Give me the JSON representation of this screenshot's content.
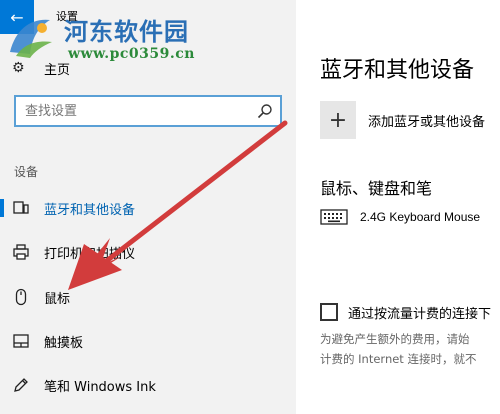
{
  "window": {
    "title": "设置",
    "back_glyph": "←"
  },
  "watermark": {
    "name": "河东软件园",
    "url": "www.pc0359.cn"
  },
  "sidebar": {
    "home_label": "主页",
    "search": {
      "placeholder": "查找设置",
      "value": ""
    },
    "section_label": "设备",
    "items": [
      {
        "label": "蓝牙和其他设备",
        "icon": "bluetooth-devices-icon",
        "active": true
      },
      {
        "label": "打印机和扫描仪",
        "icon": "printer-icon",
        "active": false
      },
      {
        "label": "鼠标",
        "icon": "mouse-icon",
        "active": false
      },
      {
        "label": "触摸板",
        "icon": "touchpad-icon",
        "active": false
      },
      {
        "label": "笔和 Windows Ink",
        "icon": "pen-icon",
        "active": false
      }
    ]
  },
  "content": {
    "page_title": "蓝牙和其他设备",
    "add_device_label": "添加蓝牙或其他设备",
    "section_title": "鼠标、键盘和笔",
    "devices": [
      {
        "name": "2.4G Keyboard Mouse",
        "icon": "keyboard-icon"
      }
    ],
    "metered_checkbox_label": "通过按流量计费的连接下",
    "metered_checked": false,
    "metered_description": [
      "为避免产生额外的费用，请始",
      "计费的 Internet 连接时，就不"
    ]
  },
  "colors": {
    "accent": "#0078d7",
    "active_text": "#0063b1",
    "sidebar_bg": "#f2f2f2",
    "annotation_arrow": "#d23c3c"
  }
}
